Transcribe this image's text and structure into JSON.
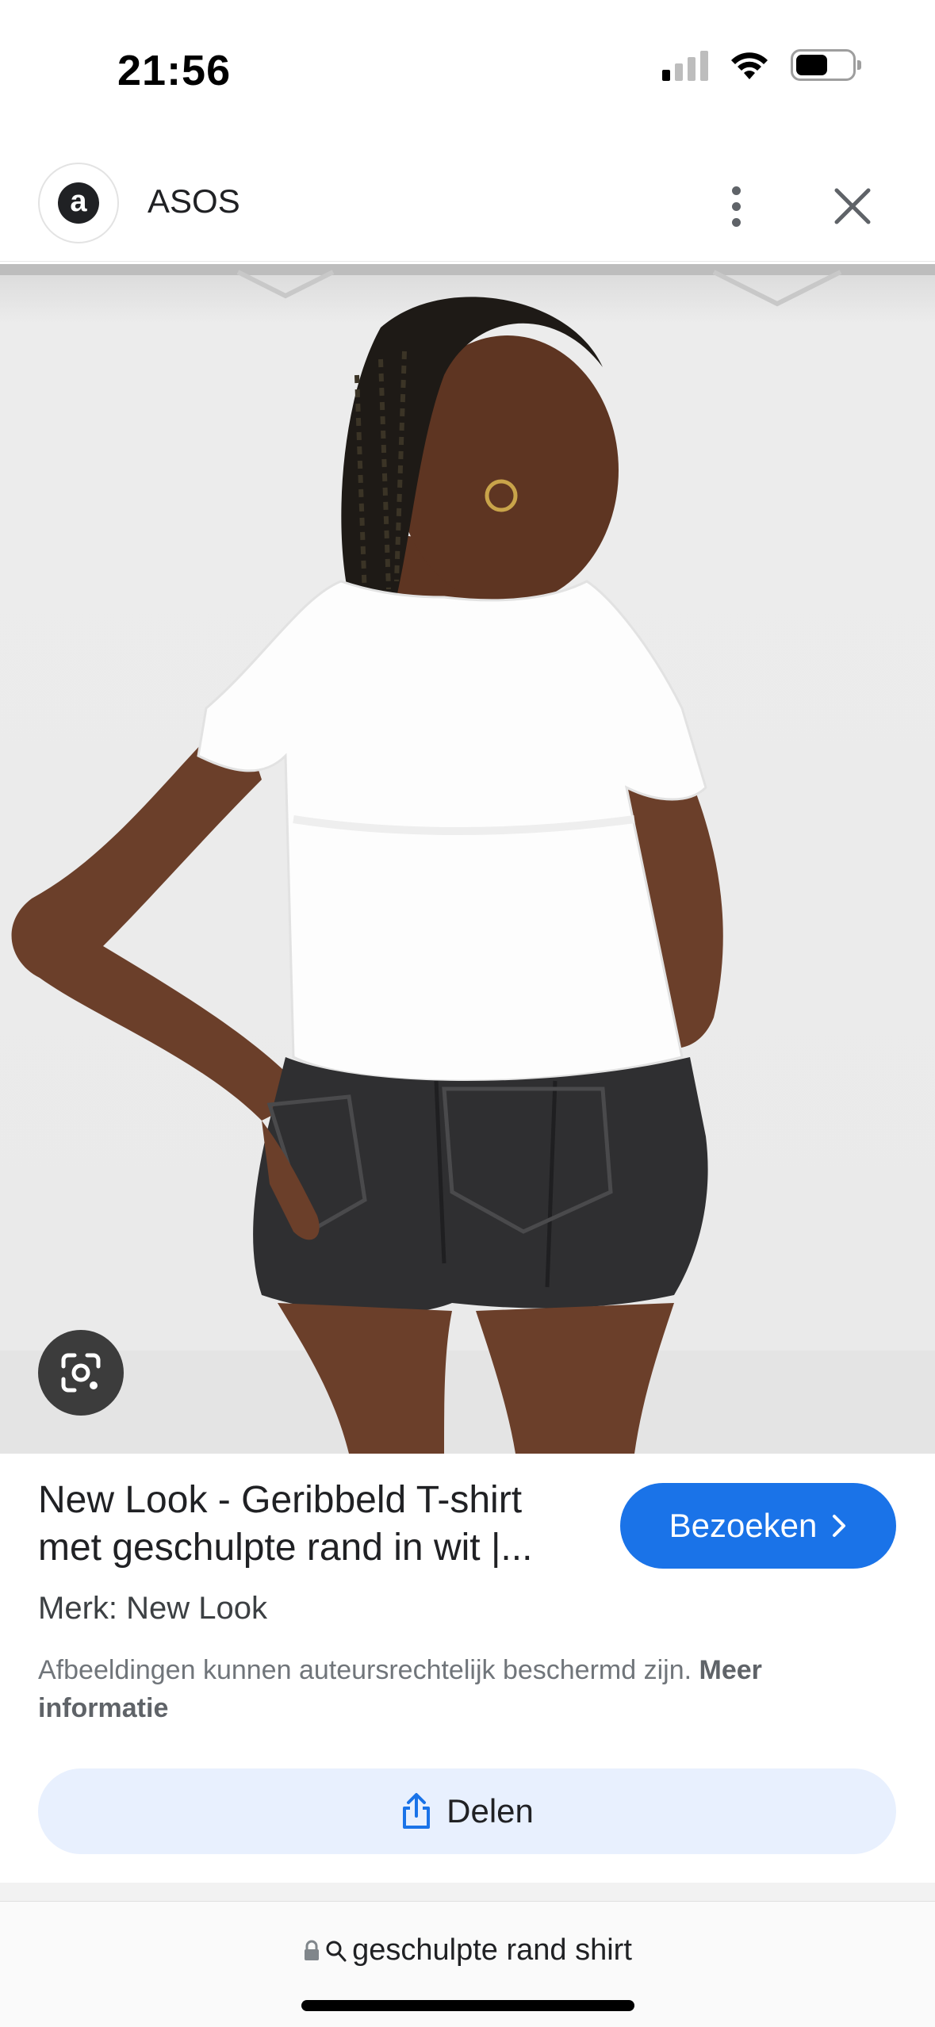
{
  "status_bar": {
    "time": "21:56",
    "signal_bars_active": 1,
    "signal_bars_total": 4,
    "battery_level": 0.55,
    "icons": [
      "signal-icon",
      "wifi-icon",
      "battery-icon"
    ]
  },
  "header": {
    "site_logo_letter": "a",
    "site_name": "ASOS",
    "more_icon": "more-vert-icon",
    "close_icon": "close-icon"
  },
  "image": {
    "lens_icon": "google-lens-icon"
  },
  "product": {
    "title": "New Look - Geribbeld T-shirt met geschulpte rand in wit |...",
    "visit_label": "Bezoeken",
    "brand_line": "Merk: New Look",
    "copyright_text": "Afbeeldingen kunnen auteursrechtelijk beschermd zijn.",
    "more_info_label": "Meer informatie",
    "share_label": "Delen"
  },
  "url_bar": {
    "query": "geschulpte rand shirt",
    "lock_icon": "lock-icon",
    "search_icon": "search-icon"
  },
  "colors": {
    "accent": "#1a73e8",
    "share_bg": "#e8f0fe",
    "text": "#202124",
    "muted": "#70757a"
  }
}
